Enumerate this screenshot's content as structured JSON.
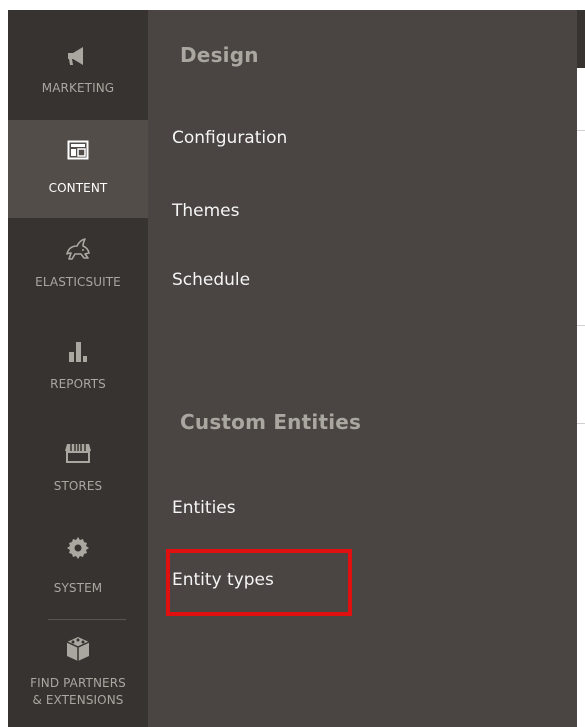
{
  "sidebar": {
    "items": [
      {
        "label": "MARKETING",
        "icon": "megaphone-icon",
        "active": false
      },
      {
        "label": "CONTENT",
        "icon": "layout-icon",
        "active": true
      },
      {
        "label": "ELASTICSUITE",
        "icon": "rabbit-icon",
        "active": false
      },
      {
        "label": "REPORTS",
        "icon": "bar-chart-icon",
        "active": false
      },
      {
        "label": "STORES",
        "icon": "storefront-icon",
        "active": false
      },
      {
        "label": "SYSTEM",
        "icon": "gear-icon",
        "active": false
      }
    ],
    "partners": {
      "label_line1": "FIND PARTNERS",
      "label_line2": "& EXTENSIONS",
      "icon": "cubes-icon"
    }
  },
  "panel": {
    "sections": [
      {
        "heading": "Design",
        "links": [
          "Configuration",
          "Themes",
          "Schedule"
        ]
      },
      {
        "heading": "Custom Entities",
        "links": [
          "Entities",
          "Entity types"
        ]
      }
    ]
  },
  "colors": {
    "sidebar_bg": "#373330",
    "active_bg": "#524d49",
    "panel_bg": "#4a4542",
    "heading": "#aaa6a0",
    "highlight": "#e11010"
  }
}
